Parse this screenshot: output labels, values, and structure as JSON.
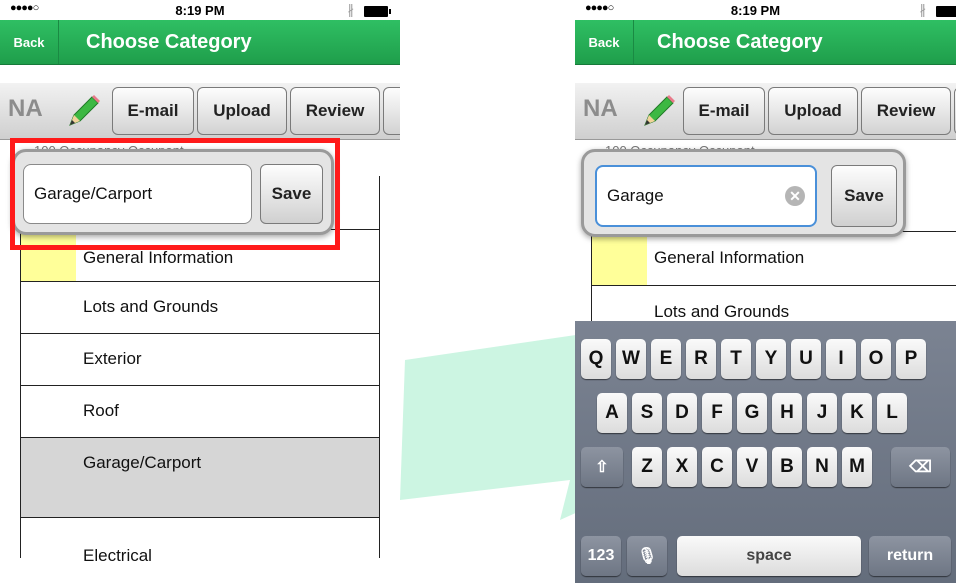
{
  "status": {
    "signal": "●●●●○",
    "time": "8:19 PM",
    "bt": "∦"
  },
  "nav": {
    "back": "Back",
    "title": "Choose Category"
  },
  "toolbar": {
    "na": "NA",
    "buttons": [
      "E-mail",
      "Upload",
      "Review"
    ]
  },
  "left": {
    "partial_header": "100 Occupancy Occupant",
    "input_value": "Garage/Carport",
    "save": "Save",
    "rows": [
      "General Information",
      "Lots and Grounds",
      "Exterior",
      "Roof",
      "Garage/Carport",
      "Electrical"
    ]
  },
  "right": {
    "input_value": "Garage",
    "save": "Save",
    "rows": [
      "General Information",
      "Lots and Grounds"
    ],
    "keyboard": {
      "row1": [
        "Q",
        "W",
        "E",
        "R",
        "T",
        "Y",
        "U",
        "I",
        "O",
        "P"
      ],
      "row2": [
        "A",
        "S",
        "D",
        "F",
        "G",
        "H",
        "J",
        "K",
        "L"
      ],
      "row3": [
        "Z",
        "X",
        "C",
        "V",
        "B",
        "N",
        "M"
      ],
      "num": "123",
      "space": "space",
      "return": "return"
    }
  },
  "colors": {
    "nav_green": "#22a650",
    "highlight_red": "#ff1a1a",
    "swatch_yellow": "#ffff99"
  },
  "icons": {
    "shift": "⇧",
    "delete": "⌫",
    "mic": "🎙",
    "clear": "✕"
  }
}
